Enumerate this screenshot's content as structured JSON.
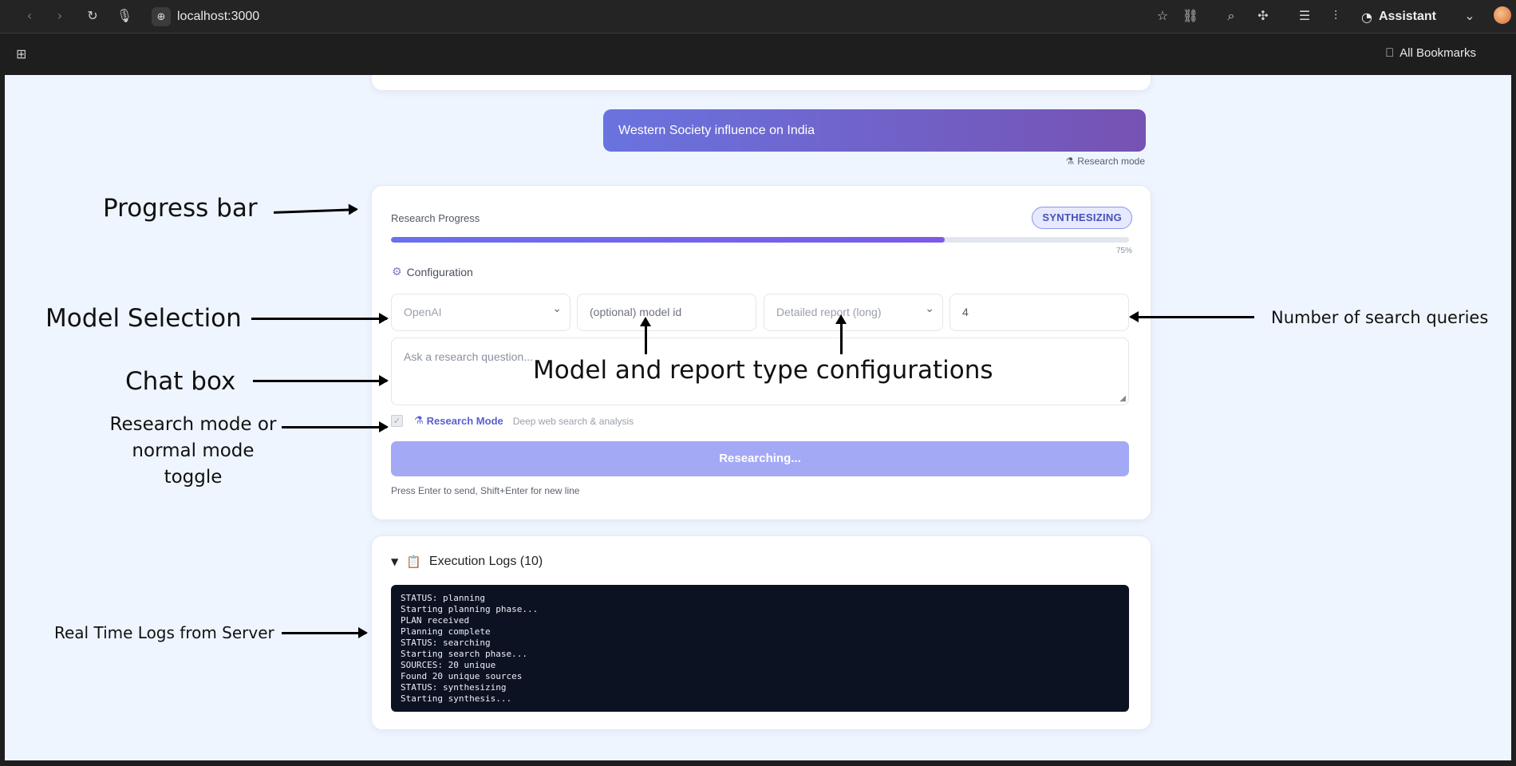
{
  "browser": {
    "url": "localhost:3000",
    "assistant_label": "Assistant",
    "all_bookmarks_label": "All Bookmarks"
  },
  "chat": {
    "user_message": "Western Society influence on India",
    "mode_tag": "Research mode"
  },
  "progress": {
    "label": "Research Progress",
    "status_badge": "SYNTHESIZING",
    "percent": 75,
    "percent_text": "75%"
  },
  "config": {
    "title": "Configuration",
    "provider_value": "OpenAI",
    "model_id_placeholder": "(optional) model id",
    "report_type_value": "Detailed report (long)",
    "num_queries_value": "4"
  },
  "input": {
    "placeholder": "Ask a research question...",
    "research_mode_label": "Research Mode",
    "research_mode_desc": "Deep web search & analysis",
    "research_mode_checked": true,
    "submit_label": "Researching...",
    "hint": "Press Enter to send, Shift+Enter for new line"
  },
  "logs": {
    "title": "Execution Logs (10)",
    "lines": [
      "STATUS: planning",
      "Starting planning phase...",
      "PLAN received",
      "Planning complete",
      "STATUS: searching",
      "Starting search phase...",
      "SOURCES: 20 unique",
      "Found 20 unique sources",
      "STATUS: synthesizing",
      "Starting synthesis..."
    ]
  },
  "annotations": {
    "progress_bar": "Progress bar",
    "model_selection": "Model Selection",
    "chat_box": "Chat box",
    "research_toggle": "Research mode or\nnormal mode\ntoggle",
    "logs": "Real Time Logs from Server",
    "model_report": "Model and report type configurations",
    "num_queries": "Number of search queries"
  }
}
